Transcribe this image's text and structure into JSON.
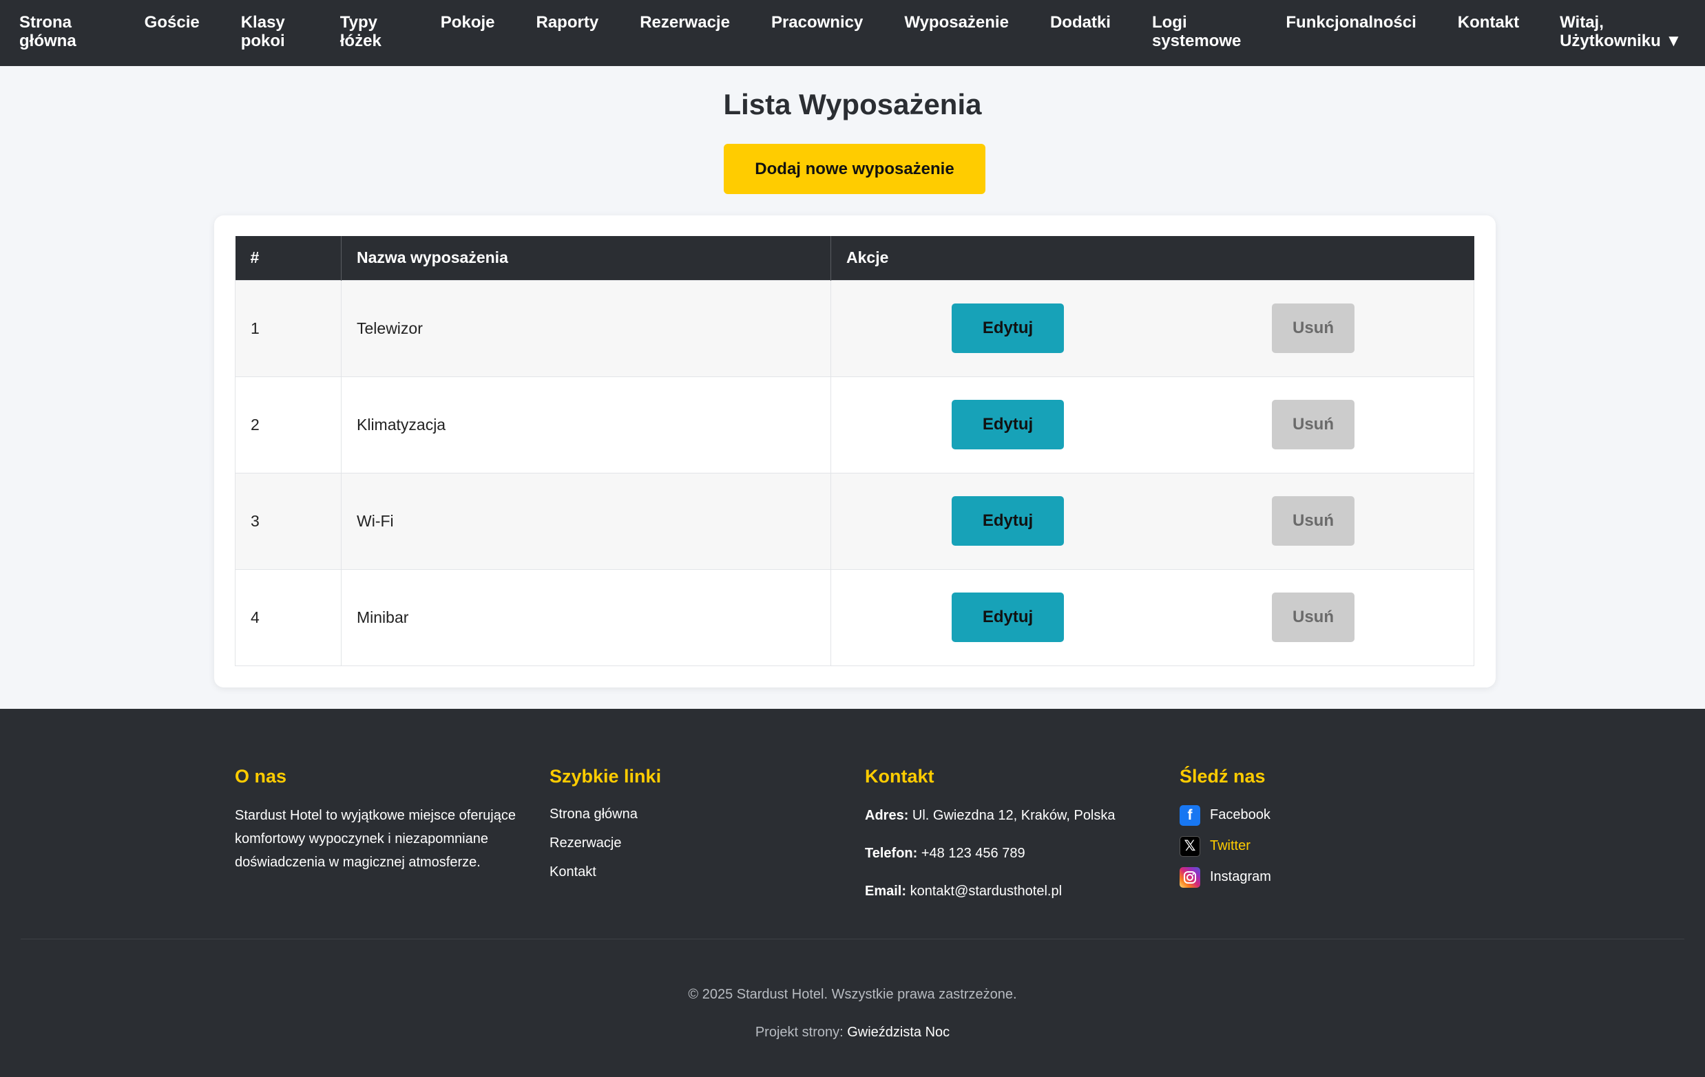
{
  "nav": {
    "items": [
      {
        "l1": "Strona",
        "l2": "główna"
      },
      {
        "l1": "Goście",
        "l2": ""
      },
      {
        "l1": "Klasy",
        "l2": "pokoi"
      },
      {
        "l1": "Typy",
        "l2": "łóżek"
      },
      {
        "l1": "Pokoje",
        "l2": ""
      },
      {
        "l1": "Raporty",
        "l2": ""
      },
      {
        "l1": "Rezerwacje",
        "l2": ""
      },
      {
        "l1": "Pracownicy",
        "l2": ""
      },
      {
        "l1": "Wyposażenie",
        "l2": ""
      },
      {
        "l1": "Dodatki",
        "l2": ""
      },
      {
        "l1": "Logi",
        "l2": "systemowe"
      },
      {
        "l1": "Funkcjonalności",
        "l2": ""
      },
      {
        "l1": "Kontakt",
        "l2": ""
      }
    ],
    "user": {
      "l1": "Witaj,",
      "l2": "Użytkowniku ▼"
    }
  },
  "main": {
    "title": "Lista Wyposażenia",
    "add_button": "Dodaj nowe wyposażenie"
  },
  "table": {
    "headers": [
      "#",
      "Nazwa wyposażenia",
      "Akcje"
    ],
    "rows": [
      {
        "num": "1",
        "name": "Telewizor"
      },
      {
        "num": "2",
        "name": "Klimatyzacja"
      },
      {
        "num": "3",
        "name": "Wi-Fi"
      },
      {
        "num": "4",
        "name": "Minibar"
      }
    ],
    "edit_label": "Edytuj",
    "delete_label": "Usuń"
  },
  "footer": {
    "about": {
      "title": "O nas",
      "text": "Stardust Hotel to wyjątkowe miejsce oferujące komfortowy wypoczynek i niezapomniane doświadczenia w magicznej atmosferze."
    },
    "quick_links": {
      "title": "Szybkie linki",
      "links": [
        "Strona główna",
        "Rezerwacje",
        "Kontakt"
      ]
    },
    "contact": {
      "title": "Kontakt",
      "address_label": "Adres:",
      "address": "Ul. Gwiezdna 12, Kraków, Polska",
      "phone_label": "Telefon:",
      "phone": "+48 123 456 789",
      "email_label": "Email:",
      "email": "kontakt@stardusthotel.pl"
    },
    "social": {
      "title": "Śledź nas",
      "items": [
        {
          "label": "Facebook",
          "icon": "facebook-icon"
        },
        {
          "label": "Twitter",
          "icon": "x-twitter-icon"
        },
        {
          "label": "Instagram",
          "icon": "instagram-icon"
        }
      ]
    },
    "copyright": "© 2025 Stardust Hotel. Wszystkie prawa zastrzeżone.",
    "design_label": "Projekt strony:",
    "design_name": "Gwieździsta Noc"
  },
  "colors": {
    "navbar": "#2b2e33",
    "accent": "#ffcc00",
    "edit": "#17a2b8",
    "delete": "#cccccc",
    "background": "#f4f6f9"
  }
}
